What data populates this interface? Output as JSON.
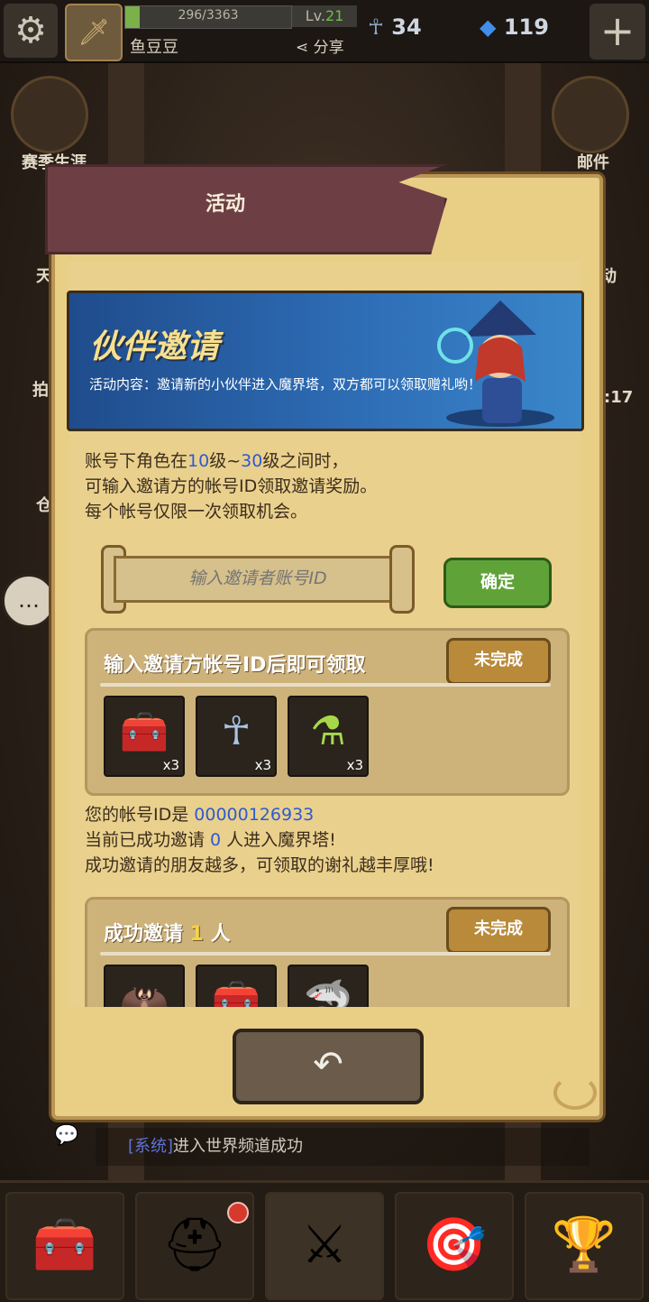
{
  "top_bar": {
    "exp_text": "296/3363",
    "exp_fraction": 0.088,
    "level_prefix": "Lv.",
    "level": "21",
    "player_name": "鱼豆豆",
    "share_label": "分享",
    "ankh_count": "34",
    "gem_count": "119"
  },
  "side_buttons": {
    "season_label": "赛季生涯",
    "mail_label": "邮件",
    "partial_left_1": "天",
    "partial_left_2": "拍",
    "partial_left_3": "仓",
    "partial_right_1": "动",
    "partial_right_time": ":17"
  },
  "modal": {
    "title": "活动",
    "banner_title": "伙伴邀请",
    "banner_desc": "活动内容：邀请新的小伙伴进入魔界塔，双方都可以领取赠礼哟！",
    "rule_line1_a": "账号下角色在",
    "rule_line1_lv1": "10",
    "rule_line1_b": "级~",
    "rule_line1_lv2": "30",
    "rule_line1_c": "级之间时，",
    "rule_line2": "可输入邀请方的帐号ID领取邀请奖励。",
    "rule_line3": "每个帐号仅限一次领取机会。",
    "input_placeholder": "输入邀请者账号ID",
    "confirm_label": "确定",
    "reward1": {
      "title": "输入邀请方帐号ID后即可领取",
      "status": "未完成",
      "items": [
        {
          "icon": "treasure-chest-icon",
          "count": "x3"
        },
        {
          "icon": "ankh-icon",
          "count": "x3"
        },
        {
          "icon": "potion-icon",
          "count": "x3"
        }
      ]
    },
    "account_id_prefix": "您的帐号ID是 ",
    "account_id": "00000126933",
    "invited_prefix": "当前已成功邀请 ",
    "invited_count": "0",
    "invited_suffix": " 人进入魔界塔!",
    "more_friends": "成功邀请的朋友越多，可领取的谢礼越丰厚哦!",
    "reward2": {
      "title_prefix": "成功邀请 ",
      "title_count": "1",
      "title_suffix": " 人",
      "status": "未完成",
      "items": [
        {
          "icon": "hero-portrait-icon"
        },
        {
          "icon": "treasure-chest-icon"
        },
        {
          "icon": "shark-pet-icon"
        }
      ]
    },
    "back_icon": "back-arrow-icon"
  },
  "system_message": {
    "tag": "[系统]",
    "text": "进入世界频道成功"
  },
  "bottom_nav": [
    {
      "icon": "treasure-chest-icon"
    },
    {
      "icon": "knight-helmet-icon"
    },
    {
      "icon": "crossed-swords-icon"
    },
    {
      "icon": "target-icon"
    },
    {
      "icon": "trophy-icon"
    }
  ]
}
